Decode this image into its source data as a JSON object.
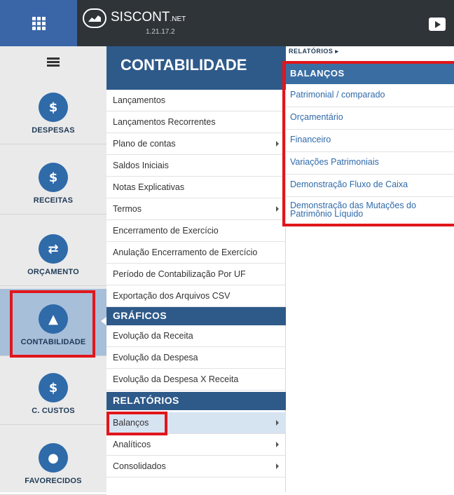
{
  "header": {
    "brand_name": "SISCONT",
    "brand_suffix": ".NET",
    "version": "1.21.17.2"
  },
  "sidebar": {
    "items": [
      {
        "label": "DESPESAS",
        "icon": "dollar-out-icon",
        "glyph": "$"
      },
      {
        "label": "RECEITAS",
        "icon": "dollar-in-icon",
        "glyph": "$"
      },
      {
        "label": "ORÇAMENTO",
        "icon": "exchange-icon",
        "glyph": "⇄"
      },
      {
        "label": "CONTABILIDADE",
        "icon": "chart-icon",
        "glyph": "▲",
        "active": true
      },
      {
        "label": "C. CUSTOS",
        "icon": "cost-center-icon",
        "glyph": "$"
      },
      {
        "label": "FAVORECIDOS",
        "icon": "user-icon",
        "glyph": "●"
      }
    ]
  },
  "menu": {
    "title": "CONTABILIDADE",
    "items": [
      {
        "label": "Lançamentos"
      },
      {
        "label": "Lançamentos Recorrentes"
      },
      {
        "label": "Plano de contas",
        "submenu": true
      },
      {
        "label": "Saldos Iniciais"
      },
      {
        "label": "Notas Explicativas"
      },
      {
        "label": "Termos",
        "submenu": true
      },
      {
        "label": "Encerramento de Exercício"
      },
      {
        "label": "Anulação Encerramento de Exercício"
      },
      {
        "label": "Período de Contabilização Por UF"
      },
      {
        "label": "Exportação dos Arquivos CSV"
      }
    ],
    "sections": {
      "graficos": {
        "title": "GRÁFICOS",
        "items": [
          {
            "label": "Evolução da Receita"
          },
          {
            "label": "Evolução da Despesa"
          },
          {
            "label": "Evolução da Despesa X Receita"
          }
        ]
      },
      "relatorios": {
        "title": "RELATÓRIOS",
        "items": [
          {
            "label": "Balanços",
            "submenu": true,
            "selected": true
          },
          {
            "label": "Analíticos",
            "submenu": true
          },
          {
            "label": "Consolidados",
            "submenu": true
          }
        ]
      }
    }
  },
  "submenu": {
    "breadcrumb": "RELATÓRIOS ▸",
    "title": "BALANÇOS",
    "items": [
      {
        "label": "Patrimonial / comparado"
      },
      {
        "label": "Orçamentário"
      },
      {
        "label": "Financeiro"
      },
      {
        "label": "Variações Patrimoniais"
      },
      {
        "label": "Demonstração Fluxo de Caixa"
      },
      {
        "label": "Demonstração das Mutações do Patrimônio Líquido"
      }
    ]
  },
  "colors": {
    "topbar": "#2f3439",
    "primary": "#2e5a8a",
    "link": "#2f6aa9",
    "highlight": "#e0161c"
  }
}
